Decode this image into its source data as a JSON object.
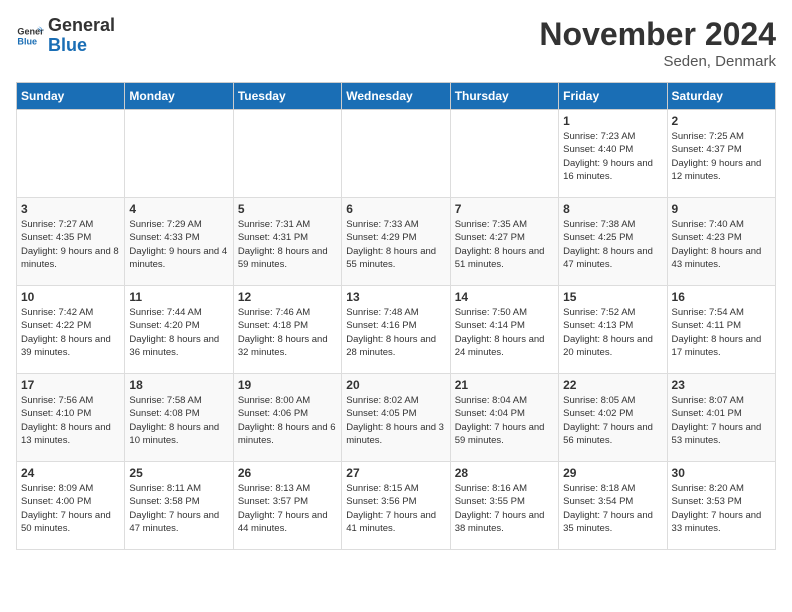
{
  "logo": {
    "line1": "General",
    "line2": "Blue"
  },
  "title": "November 2024",
  "location": "Seden, Denmark",
  "days_header": [
    "Sunday",
    "Monday",
    "Tuesday",
    "Wednesday",
    "Thursday",
    "Friday",
    "Saturday"
  ],
  "weeks": [
    [
      {
        "day": "",
        "info": ""
      },
      {
        "day": "",
        "info": ""
      },
      {
        "day": "",
        "info": ""
      },
      {
        "day": "",
        "info": ""
      },
      {
        "day": "",
        "info": ""
      },
      {
        "day": "1",
        "info": "Sunrise: 7:23 AM\nSunset: 4:40 PM\nDaylight: 9 hours and 16 minutes."
      },
      {
        "day": "2",
        "info": "Sunrise: 7:25 AM\nSunset: 4:37 PM\nDaylight: 9 hours and 12 minutes."
      }
    ],
    [
      {
        "day": "3",
        "info": "Sunrise: 7:27 AM\nSunset: 4:35 PM\nDaylight: 9 hours and 8 minutes."
      },
      {
        "day": "4",
        "info": "Sunrise: 7:29 AM\nSunset: 4:33 PM\nDaylight: 9 hours and 4 minutes."
      },
      {
        "day": "5",
        "info": "Sunrise: 7:31 AM\nSunset: 4:31 PM\nDaylight: 8 hours and 59 minutes."
      },
      {
        "day": "6",
        "info": "Sunrise: 7:33 AM\nSunset: 4:29 PM\nDaylight: 8 hours and 55 minutes."
      },
      {
        "day": "7",
        "info": "Sunrise: 7:35 AM\nSunset: 4:27 PM\nDaylight: 8 hours and 51 minutes."
      },
      {
        "day": "8",
        "info": "Sunrise: 7:38 AM\nSunset: 4:25 PM\nDaylight: 8 hours and 47 minutes."
      },
      {
        "day": "9",
        "info": "Sunrise: 7:40 AM\nSunset: 4:23 PM\nDaylight: 8 hours and 43 minutes."
      }
    ],
    [
      {
        "day": "10",
        "info": "Sunrise: 7:42 AM\nSunset: 4:22 PM\nDaylight: 8 hours and 39 minutes."
      },
      {
        "day": "11",
        "info": "Sunrise: 7:44 AM\nSunset: 4:20 PM\nDaylight: 8 hours and 36 minutes."
      },
      {
        "day": "12",
        "info": "Sunrise: 7:46 AM\nSunset: 4:18 PM\nDaylight: 8 hours and 32 minutes."
      },
      {
        "day": "13",
        "info": "Sunrise: 7:48 AM\nSunset: 4:16 PM\nDaylight: 8 hours and 28 minutes."
      },
      {
        "day": "14",
        "info": "Sunrise: 7:50 AM\nSunset: 4:14 PM\nDaylight: 8 hours and 24 minutes."
      },
      {
        "day": "15",
        "info": "Sunrise: 7:52 AM\nSunset: 4:13 PM\nDaylight: 8 hours and 20 minutes."
      },
      {
        "day": "16",
        "info": "Sunrise: 7:54 AM\nSunset: 4:11 PM\nDaylight: 8 hours and 17 minutes."
      }
    ],
    [
      {
        "day": "17",
        "info": "Sunrise: 7:56 AM\nSunset: 4:10 PM\nDaylight: 8 hours and 13 minutes."
      },
      {
        "day": "18",
        "info": "Sunrise: 7:58 AM\nSunset: 4:08 PM\nDaylight: 8 hours and 10 minutes."
      },
      {
        "day": "19",
        "info": "Sunrise: 8:00 AM\nSunset: 4:06 PM\nDaylight: 8 hours and 6 minutes."
      },
      {
        "day": "20",
        "info": "Sunrise: 8:02 AM\nSunset: 4:05 PM\nDaylight: 8 hours and 3 minutes."
      },
      {
        "day": "21",
        "info": "Sunrise: 8:04 AM\nSunset: 4:04 PM\nDaylight: 7 hours and 59 minutes."
      },
      {
        "day": "22",
        "info": "Sunrise: 8:05 AM\nSunset: 4:02 PM\nDaylight: 7 hours and 56 minutes."
      },
      {
        "day": "23",
        "info": "Sunrise: 8:07 AM\nSunset: 4:01 PM\nDaylight: 7 hours and 53 minutes."
      }
    ],
    [
      {
        "day": "24",
        "info": "Sunrise: 8:09 AM\nSunset: 4:00 PM\nDaylight: 7 hours and 50 minutes."
      },
      {
        "day": "25",
        "info": "Sunrise: 8:11 AM\nSunset: 3:58 PM\nDaylight: 7 hours and 47 minutes."
      },
      {
        "day": "26",
        "info": "Sunrise: 8:13 AM\nSunset: 3:57 PM\nDaylight: 7 hours and 44 minutes."
      },
      {
        "day": "27",
        "info": "Sunrise: 8:15 AM\nSunset: 3:56 PM\nDaylight: 7 hours and 41 minutes."
      },
      {
        "day": "28",
        "info": "Sunrise: 8:16 AM\nSunset: 3:55 PM\nDaylight: 7 hours and 38 minutes."
      },
      {
        "day": "29",
        "info": "Sunrise: 8:18 AM\nSunset: 3:54 PM\nDaylight: 7 hours and 35 minutes."
      },
      {
        "day": "30",
        "info": "Sunrise: 8:20 AM\nSunset: 3:53 PM\nDaylight: 7 hours and 33 minutes."
      }
    ]
  ]
}
